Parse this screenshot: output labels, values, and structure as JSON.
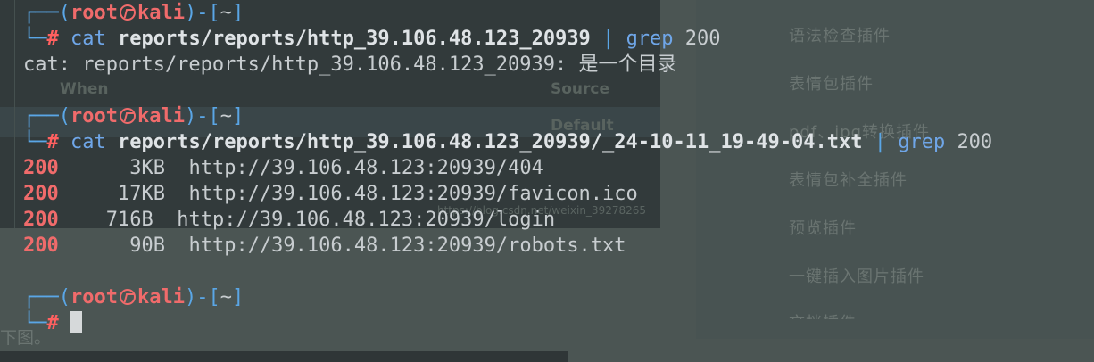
{
  "background": {
    "left_panel": {
      "header_when": "When",
      "header_source": "Source",
      "default_label": "Default",
      "watermark": "https://blog.csdn.net/weixin_39278265"
    },
    "right_menu": [
      "语法检查插件",
      "表情包插件",
      "pdf、jpg转换插件",
      "表情包补全插件",
      "预览插件",
      "一键插入图片插件",
      "文档插件"
    ],
    "footer_text": "下图。"
  },
  "terminal": {
    "prompt": {
      "open": "┌──(",
      "user": "root",
      "host": "kali",
      "close": ")-[",
      "cwd": "~",
      "end": "]",
      "arrow": "└─",
      "hash": "#"
    },
    "block1": {
      "command": "cat",
      "path": "reports/reports/http_39.106.48.123_20939",
      "pipe": "|",
      "grep": "grep",
      "grep_arg": "200",
      "output": "cat: reports/reports/http_39.106.48.123_20939: 是一个目录"
    },
    "block2": {
      "command": "cat",
      "path": "reports/reports/http_39.106.48.123_20939/_24-10-11_19-49-04.txt",
      "pipe": "|",
      "grep": "grep",
      "grep_arg": "200",
      "rows": [
        {
          "code": "200",
          "size": "  3KB",
          "url": "http://39.106.48.123:20939/404"
        },
        {
          "code": "200",
          "size": " 17KB",
          "url": "http://39.106.48.123:20939/favicon.ico"
        },
        {
          "code": "200",
          "size": "716B ",
          "url": "http://39.106.48.123:20939/login"
        },
        {
          "code": "200",
          "size": "  90B ",
          "url": "http://39.106.48.123:20939/robots.txt"
        }
      ]
    }
  },
  "colors": {
    "prompt_blue": "#5aa6e6",
    "root_red": "#f06b6b",
    "text": "#c8cdd0",
    "cursor": "#d6d9da"
  }
}
